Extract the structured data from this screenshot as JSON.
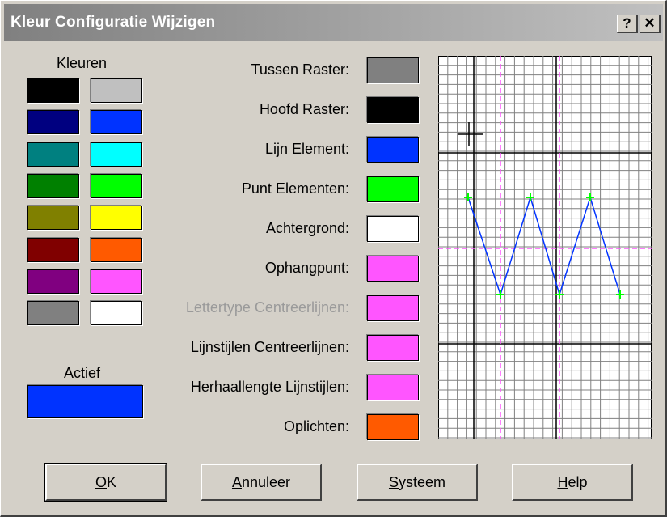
{
  "window": {
    "title": "Kleur Configuratie Wijzigen",
    "help_glyph": "?",
    "close_glyph": "✕"
  },
  "palette": {
    "heading": "Kleuren",
    "colors": [
      [
        "#000000",
        "#c0c0c0"
      ],
      [
        "#000080",
        "#0033ff"
      ],
      [
        "#008080",
        "#00ffff"
      ],
      [
        "#008000",
        "#00ff00"
      ],
      [
        "#808000",
        "#ffff00"
      ],
      [
        "#800000",
        "#ff5a00"
      ],
      [
        "#800080",
        "#ff55ff"
      ],
      [
        "#808080",
        "#ffffff"
      ]
    ]
  },
  "active": {
    "label": "Actief",
    "color": "#0033ff"
  },
  "settings": [
    {
      "label": "Tussen Raster:",
      "color": "#808080",
      "enabled": true
    },
    {
      "label": "Hoofd Raster:",
      "color": "#000000",
      "enabled": true
    },
    {
      "label": "Lijn Element:",
      "color": "#0033ff",
      "enabled": true
    },
    {
      "label": "Punt Elementen:",
      "color": "#00ff00",
      "enabled": true
    },
    {
      "label": "Achtergrond:",
      "color": "#ffffff",
      "enabled": true
    },
    {
      "label": "Ophangpunt:",
      "color": "#ff55ff",
      "enabled": true
    },
    {
      "label": "Lettertype Centreerlijnen:",
      "color": "#ff55ff",
      "enabled": false
    },
    {
      "label": "Lijnstijlen Centreerlijnen:",
      "color": "#ff55ff",
      "enabled": true
    },
    {
      "label": "Herhaallengte Lijnstijlen:",
      "color": "#ff55ff",
      "enabled": true
    },
    {
      "label": "Oplichten:",
      "color": "#ff5a00",
      "enabled": true
    }
  ],
  "buttons": {
    "ok": {
      "label": "OK",
      "mnemonic_index": 0
    },
    "cancel": {
      "label": "Annuleer",
      "mnemonic_index": 0
    },
    "system": {
      "label": "Systeem",
      "mnemonic_index": 0
    },
    "help": {
      "label": "Help",
      "mnemonic_index": 0
    }
  },
  "preview": {
    "colors": {
      "minor_grid": "#808080",
      "major_grid": "#000000",
      "line": "#0033ff",
      "points": "#00ff00",
      "background": "#ffffff",
      "center_lines": "#ff55ff"
    }
  }
}
